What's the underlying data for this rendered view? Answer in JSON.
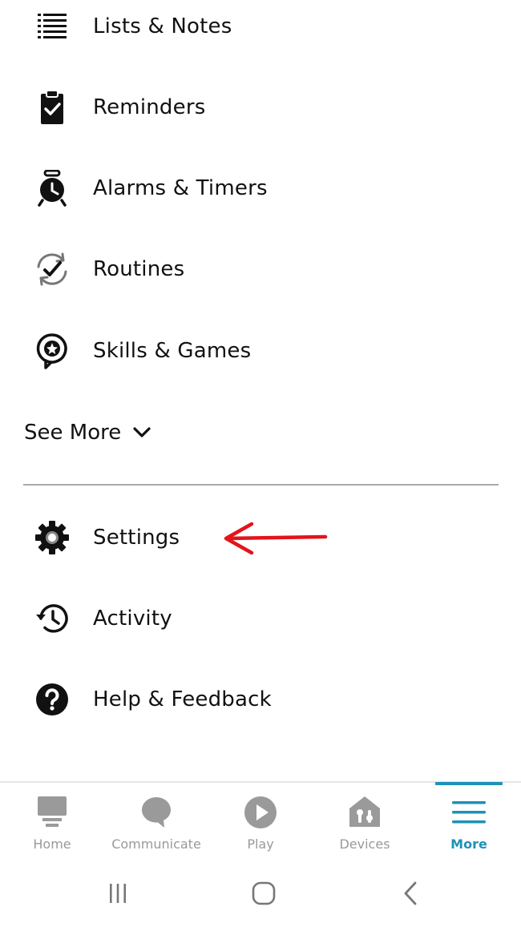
{
  "menu": {
    "items": [
      {
        "label": "Lists & Notes",
        "icon": "list-icon"
      },
      {
        "label": "Reminders",
        "icon": "clipboard-check-icon"
      },
      {
        "label": "Alarms & Timers",
        "icon": "alarm-clock-icon"
      },
      {
        "label": "Routines",
        "icon": "routine-check-icon"
      },
      {
        "label": "Skills & Games",
        "icon": "skills-star-icon"
      }
    ],
    "see_more_label": "See More",
    "settings_items": [
      {
        "label": "Settings",
        "icon": "gear-icon"
      },
      {
        "label": "Activity",
        "icon": "history-icon"
      },
      {
        "label": "Help & Feedback",
        "icon": "question-icon"
      }
    ]
  },
  "annotation": {
    "color": "#e3141b",
    "target": "Settings",
    "icon": "red-arrow"
  },
  "bottom_nav": {
    "tabs": [
      {
        "label": "Home",
        "icon": "home-icon",
        "active": false
      },
      {
        "label": "Communicate",
        "icon": "chat-bubble-icon",
        "active": false
      },
      {
        "label": "Play",
        "icon": "play-icon",
        "active": false
      },
      {
        "label": "Devices",
        "icon": "devices-icon",
        "active": false
      },
      {
        "label": "More",
        "icon": "hamburger-icon",
        "active": true
      }
    ],
    "active_color": "#1d92b8",
    "inactive_color": "#9a9a9a"
  },
  "system_nav": {
    "buttons": [
      "recent-apps-icon",
      "home-circle-icon",
      "back-icon"
    ]
  }
}
